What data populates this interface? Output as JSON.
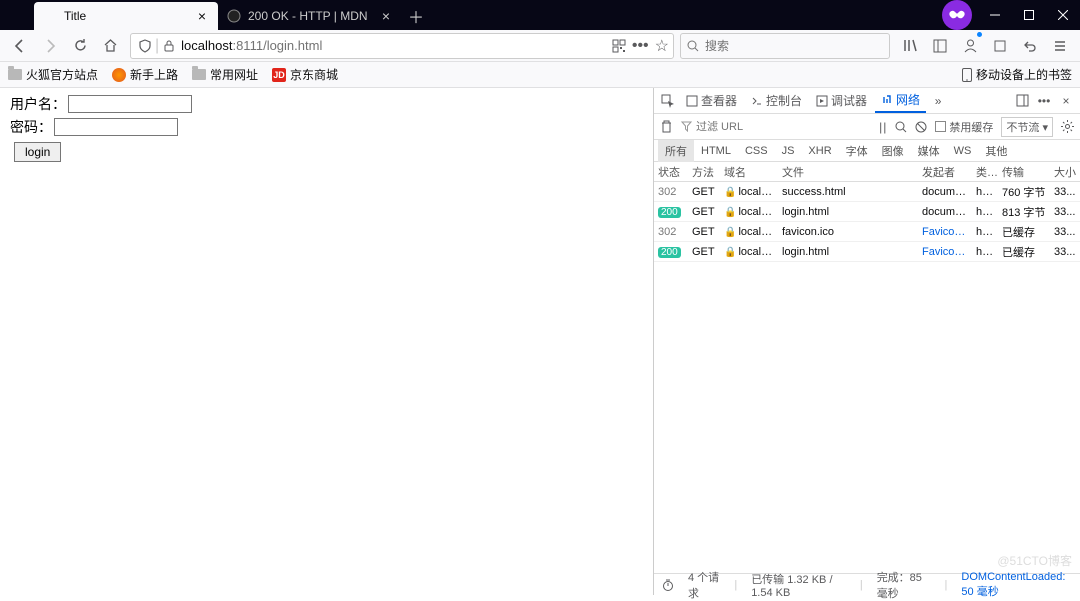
{
  "tabs": [
    {
      "title": "Title",
      "active": true
    },
    {
      "title": "200 OK - HTTP | MDN",
      "active": false
    }
  ],
  "url": {
    "host": "localhost",
    "port": ":8111",
    "path": "/login.html"
  },
  "search_placeholder": "搜索",
  "bookmarks": {
    "items": [
      "火狐官方站点",
      "新手上路",
      "常用网址",
      "京东商城"
    ],
    "mobile": "移动设备上的书签"
  },
  "page": {
    "username_label": "用户名：",
    "password_label": "密码：",
    "login_button": "login"
  },
  "devtools": {
    "tabs": {
      "inspector": "查看器",
      "console": "控制台",
      "debugger": "调试器",
      "network": "网络"
    },
    "filter_placeholder": "过滤 URL",
    "disable_cache": "禁用缓存",
    "throttle": "不节流",
    "filters": [
      "所有",
      "HTML",
      "CSS",
      "JS",
      "XHR",
      "字体",
      "图像",
      "媒体",
      "WS",
      "其他"
    ],
    "columns": {
      "status": "状态",
      "method": "方法",
      "domain": "域名",
      "file": "文件",
      "initiator": "发起者",
      "type": "类型",
      "transferred": "传输",
      "size": "大小"
    },
    "rows": [
      {
        "status": "302",
        "s200": false,
        "method": "GET",
        "domain": "localh...",
        "file": "success.html",
        "initiator": "document",
        "initLink": false,
        "type": "ht...",
        "trans": "760 字节",
        "size": "33..."
      },
      {
        "status": "200",
        "s200": true,
        "method": "GET",
        "domain": "localh...",
        "file": "login.html",
        "initiator": "document",
        "initLink": false,
        "type": "ht...",
        "trans": "813 字节",
        "size": "33..."
      },
      {
        "status": "302",
        "s200": false,
        "method": "GET",
        "domain": "localh...",
        "file": "favicon.ico",
        "initiator": "FaviconL...",
        "initLink": true,
        "type": "ht...",
        "trans": "已缓存",
        "size": "33..."
      },
      {
        "status": "200",
        "s200": true,
        "method": "GET",
        "domain": "localh...",
        "file": "login.html",
        "initiator": "FaviconL...",
        "initLink": true,
        "type": "ht...",
        "trans": "已缓存",
        "size": "33..."
      }
    ],
    "status": {
      "requests": "4 个请求",
      "transferred": "已传输 1.32 KB / 1.54 KB",
      "finish": "完成：85 毫秒",
      "dom": "DOMContentLoaded: 50 毫秒"
    }
  },
  "watermark": "@51CTO博客"
}
